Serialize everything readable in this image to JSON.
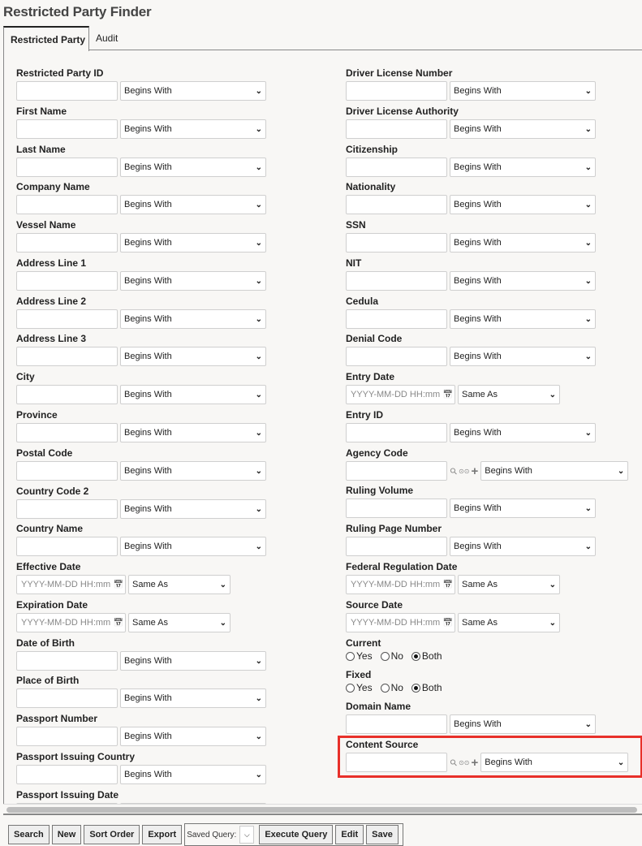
{
  "page_title": "Restricted Party Finder",
  "tabs": [
    {
      "label": "Restricted Party",
      "active": true
    },
    {
      "label": "Audit",
      "active": false
    }
  ],
  "left_fields": [
    {
      "label": "Restricted Party ID",
      "type": "text",
      "operator": "Begins With"
    },
    {
      "label": "First Name",
      "type": "text",
      "operator": "Begins With"
    },
    {
      "label": "Last Name",
      "type": "text",
      "operator": "Begins With"
    },
    {
      "label": "Company Name",
      "type": "text",
      "operator": "Begins With"
    },
    {
      "label": "Vessel Name",
      "type": "text",
      "operator": "Begins With"
    },
    {
      "label": "Address Line 1",
      "type": "text",
      "operator": "Begins With"
    },
    {
      "label": "Address Line 2",
      "type": "text",
      "operator": "Begins With"
    },
    {
      "label": "Address Line 3",
      "type": "text",
      "operator": "Begins With"
    },
    {
      "label": "City",
      "type": "text",
      "operator": "Begins With"
    },
    {
      "label": "Province",
      "type": "text",
      "operator": "Begins With"
    },
    {
      "label": "Postal Code",
      "type": "text",
      "operator": "Begins With"
    },
    {
      "label": "Country Code 2",
      "type": "text",
      "operator": "Begins With"
    },
    {
      "label": "Country Name",
      "type": "text",
      "operator": "Begins With"
    },
    {
      "label": "Effective Date",
      "type": "date",
      "placeholder": "YYYY-MM-DD HH:mm",
      "operator": "Same As"
    },
    {
      "label": "Expiration Date",
      "type": "date",
      "placeholder": "YYYY-MM-DD HH:mm",
      "operator": "Same As"
    },
    {
      "label": "Date of Birth",
      "type": "text",
      "operator": "Begins With"
    },
    {
      "label": "Place of Birth",
      "type": "text",
      "operator": "Begins With"
    },
    {
      "label": "Passport Number",
      "type": "text",
      "operator": "Begins With"
    },
    {
      "label": "Passport Issuing Country",
      "type": "text",
      "operator": "Begins With"
    },
    {
      "label": "Passport Issuing Date",
      "type": "text",
      "operator": ""
    }
  ],
  "right_fields": [
    {
      "label": "Driver License Number",
      "type": "text",
      "operator": "Begins With"
    },
    {
      "label": "Driver License Authority",
      "type": "text",
      "operator": "Begins With"
    },
    {
      "label": "Citizenship",
      "type": "text",
      "operator": "Begins With"
    },
    {
      "label": "Nationality",
      "type": "text",
      "operator": "Begins With"
    },
    {
      "label": "SSN",
      "type": "text",
      "operator": "Begins With"
    },
    {
      "label": "NIT",
      "type": "text",
      "operator": "Begins With"
    },
    {
      "label": "Cedula",
      "type": "text",
      "operator": "Begins With"
    },
    {
      "label": "Denial Code",
      "type": "text",
      "operator": "Begins With"
    },
    {
      "label": "Entry Date",
      "type": "date",
      "placeholder": "YYYY-MM-DD HH:mm",
      "operator": "Same As"
    },
    {
      "label": "Entry ID",
      "type": "text",
      "operator": "Begins With"
    },
    {
      "label": "Agency Code",
      "type": "lookup",
      "operator": "Begins With"
    },
    {
      "label": "Ruling Volume",
      "type": "text",
      "operator": "Begins With"
    },
    {
      "label": "Ruling Page Number",
      "type": "text",
      "operator": "Begins With"
    },
    {
      "label": "Federal Regulation Date",
      "type": "date",
      "placeholder": "YYYY-MM-DD HH:mm",
      "operator": "Same As"
    },
    {
      "label": "Source Date",
      "type": "date",
      "placeholder": "YYYY-MM-DD HH:mm",
      "operator": "Same As"
    },
    {
      "label": "Current",
      "type": "radio",
      "options": [
        "Yes",
        "No",
        "Both"
      ],
      "selected": "Both"
    },
    {
      "label": "Fixed",
      "type": "radio",
      "options": [
        "Yes",
        "No",
        "Both"
      ],
      "selected": "Both"
    },
    {
      "label": "Domain Name",
      "type": "text",
      "operator": "Begins With"
    },
    {
      "label": "Content Source",
      "type": "lookup",
      "operator": "Begins With",
      "highlighted": true
    }
  ],
  "toolbar": {
    "search": "Search",
    "new": "New",
    "sort_order": "Sort Order",
    "export": "Export",
    "saved_query_label": "Saved Query:",
    "saved_query_value": "",
    "execute_query": "Execute Query",
    "edit": "Edit",
    "save": "Save"
  },
  "colors": {
    "highlight": "#e8302a",
    "background": "#f8f7f5"
  }
}
